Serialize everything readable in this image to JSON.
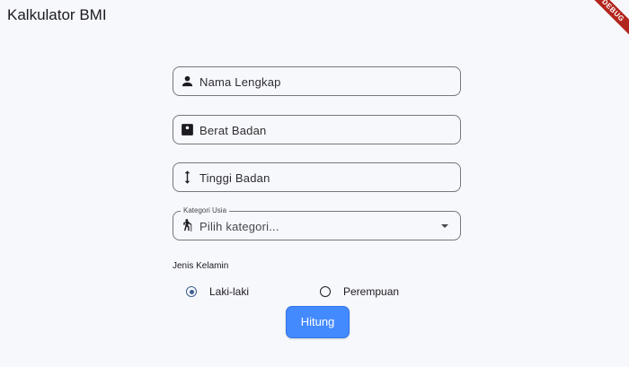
{
  "app": {
    "title": "Kalkulator BMI",
    "debug_badge": "DEBUG"
  },
  "form": {
    "name_field": {
      "label": "Nama Lengkap",
      "icon": "person-icon"
    },
    "weight_field": {
      "label": "Berat Badan",
      "icon": "scale-icon"
    },
    "height_field": {
      "label": "Tinggi Badan",
      "icon": "height-arrows-icon"
    },
    "age_category": {
      "legend": "Kategori Usia",
      "placeholder": "Pilih kategori...",
      "icon": "hiking-person-icon"
    },
    "gender": {
      "label": "Jenis Kelamin",
      "options": [
        {
          "label": "Laki-laki",
          "selected": true
        },
        {
          "label": "Perempuan",
          "selected": false
        }
      ]
    },
    "submit_label": "Hitung"
  },
  "colors": {
    "accent": "#448aff",
    "radio_selected": "#3f5f90",
    "background": "#f7f8fc",
    "debug_ribbon": "#b3261e"
  }
}
